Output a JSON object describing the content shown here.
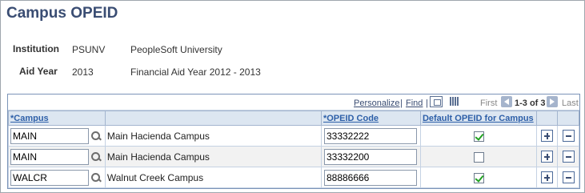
{
  "page": {
    "title": "Campus OPEID"
  },
  "institution": {
    "label": "Institution",
    "code": "PSUNV",
    "name": "PeopleSoft University"
  },
  "aid_year": {
    "label": "Aid Year",
    "code": "2013",
    "name": "Financial Aid Year 2012 - 2013"
  },
  "grid": {
    "nav": {
      "personalize": "Personalize",
      "separator": "|",
      "find": "Find",
      "first": "First",
      "count": "1-3 of 3",
      "last": "Last",
      "icons": [
        "view-all-icon",
        "download-grid-icon",
        "previous-arrow-icon",
        "next-arrow-icon"
      ]
    },
    "columns": {
      "campus": "*Campus",
      "description": "",
      "opeid": "*OPEID Code",
      "default": "Default OPEID for Campus"
    },
    "rows": [
      {
        "campus": "MAIN",
        "description": "Main Hacienda Campus",
        "opeid": "33332222",
        "default": true
      },
      {
        "campus": "MAIN",
        "description": "Main Hacienda Campus",
        "opeid": "33332200",
        "default": false
      },
      {
        "campus": "WALCR",
        "description": "Walnut Creek Campus",
        "opeid": "88886666",
        "default": true
      }
    ]
  },
  "colors": {
    "title": "#3a4d73",
    "header_bg": "#dce6f1",
    "link": "#2d5fa8",
    "check": "#21a121"
  }
}
